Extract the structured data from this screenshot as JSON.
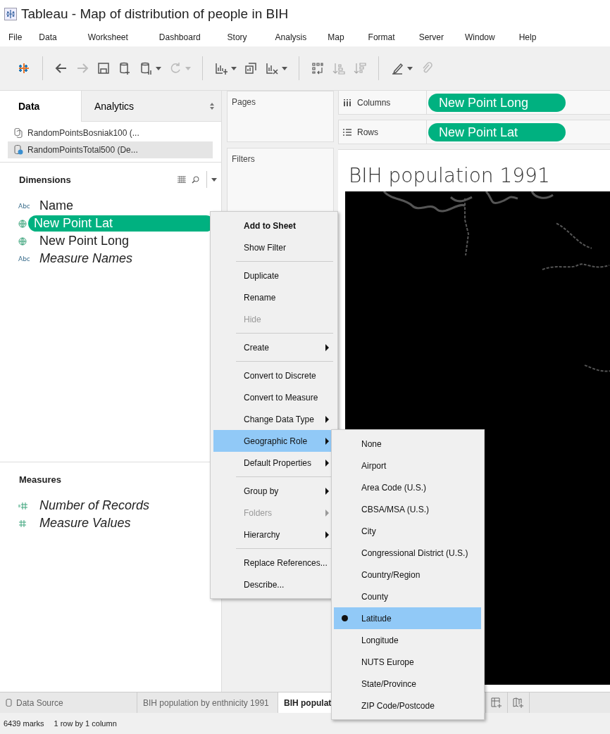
{
  "window": {
    "title": "Tableau - Map of distribution of people in BIH"
  },
  "menu_bar": [
    "File",
    "Data",
    "Worksheet",
    "Dashboard",
    "Story",
    "Analysis",
    "Map",
    "Format",
    "Server",
    "Window",
    "Help"
  ],
  "side_tabs": [
    {
      "label": "Data",
      "selected": true
    },
    {
      "label": "Analytics",
      "selected": false
    }
  ],
  "data_sources": [
    {
      "label": "RandomPointsBosniak100 (...",
      "kind": "linked",
      "selected": false
    },
    {
      "label": "RandomPointsTotal500 (De...",
      "kind": "primary",
      "selected": true
    }
  ],
  "dimensions": {
    "title": "Dimensions",
    "fields": [
      {
        "kind": "string",
        "type_label": "Abc",
        "name": "Name",
        "generated": false,
        "selected": false
      },
      {
        "kind": "geo",
        "name": "New Point Lat",
        "generated": false,
        "selected": true
      },
      {
        "kind": "geo",
        "name": "New Point Long",
        "generated": false,
        "selected": false
      },
      {
        "kind": "string",
        "type_label": "Abc",
        "name": "Measure Names",
        "generated": true,
        "selected": false
      }
    ]
  },
  "measures": {
    "title": "Measures",
    "fields": [
      {
        "kind": "calculated",
        "name": "Number of Records",
        "generated": true,
        "selected": false
      },
      {
        "kind": "measure",
        "name": "Measure Values",
        "generated": true,
        "selected": false
      }
    ]
  },
  "cards": [
    {
      "label": "Pages"
    },
    {
      "label": "Filters"
    }
  ],
  "columns_shelf": {
    "label": "Columns",
    "pills": [
      "New Point Long"
    ]
  },
  "rows_shelf": {
    "label": "Rows",
    "pills": [
      "New Point Lat"
    ]
  },
  "view": {
    "title": "BIH population 1991"
  },
  "context_menu": {
    "groups": [
      [
        {
          "label": "Add to Sheet",
          "bold": true,
          "disabled": false,
          "submenu": false,
          "selected": false
        },
        {
          "label": "Show Filter",
          "bold": false,
          "disabled": false,
          "submenu": false,
          "selected": false
        }
      ],
      [
        {
          "label": "Duplicate",
          "bold": false,
          "disabled": false,
          "submenu": false,
          "selected": false
        },
        {
          "label": "Rename",
          "bold": false,
          "disabled": false,
          "submenu": false,
          "selected": false
        },
        {
          "label": "Hide",
          "bold": false,
          "disabled": true,
          "submenu": false,
          "selected": false
        }
      ],
      [
        {
          "label": "Create",
          "bold": false,
          "disabled": false,
          "submenu": true,
          "selected": false
        }
      ],
      [
        {
          "label": "Convert to Discrete",
          "bold": false,
          "disabled": false,
          "submenu": false,
          "selected": false
        },
        {
          "label": "Convert to Measure",
          "bold": false,
          "disabled": false,
          "submenu": false,
          "selected": false
        },
        {
          "label": "Change Data Type",
          "bold": false,
          "disabled": false,
          "submenu": true,
          "selected": false
        },
        {
          "label": "Geographic Role",
          "bold": false,
          "disabled": false,
          "submenu": true,
          "selected": true
        },
        {
          "label": "Default Properties",
          "bold": false,
          "disabled": false,
          "submenu": true,
          "selected": false
        }
      ],
      [
        {
          "label": "Group by",
          "bold": false,
          "disabled": false,
          "submenu": true,
          "selected": false
        },
        {
          "label": "Folders",
          "bold": false,
          "disabled": true,
          "submenu": true,
          "selected": false
        },
        {
          "label": "Hierarchy",
          "bold": false,
          "disabled": false,
          "submenu": true,
          "selected": false
        }
      ],
      [
        {
          "label": "Replace References...",
          "bold": false,
          "disabled": false,
          "submenu": false,
          "selected": false
        },
        {
          "label": "Describe...",
          "bold": false,
          "disabled": false,
          "submenu": false,
          "selected": false
        }
      ]
    ]
  },
  "geographic_submenu": {
    "items": [
      {
        "label": "None",
        "selected": false,
        "checked": false
      },
      {
        "label": "Airport",
        "selected": false,
        "checked": false
      },
      {
        "label": "Area Code (U.S.)",
        "selected": false,
        "checked": false
      },
      {
        "label": "CBSA/MSA (U.S.)",
        "selected": false,
        "checked": false
      },
      {
        "label": "City",
        "selected": false,
        "checked": false
      },
      {
        "label": "Congressional District (U.S.)",
        "selected": false,
        "checked": false
      },
      {
        "label": "Country/Region",
        "selected": false,
        "checked": false
      },
      {
        "label": "County",
        "selected": false,
        "checked": false
      },
      {
        "label": "Latitude",
        "selected": true,
        "checked": true
      },
      {
        "label": "Longitude",
        "selected": false,
        "checked": false
      },
      {
        "label": "NUTS Europe",
        "selected": false,
        "checked": false
      },
      {
        "label": "State/Province",
        "selected": false,
        "checked": false
      },
      {
        "label": "ZIP Code/Postcode",
        "selected": false,
        "checked": false
      }
    ]
  },
  "sheet_tabs": [
    {
      "label": "Data Source",
      "kind": "data-source",
      "selected": false
    },
    {
      "label": "BIH population by enthnicity 1991",
      "kind": "sheet",
      "selected": false
    },
    {
      "label": "BIH populat",
      "kind": "sheet",
      "selected": true
    }
  ],
  "status_bar": [
    "6439 marks",
    "1 row by 1 column"
  ]
}
